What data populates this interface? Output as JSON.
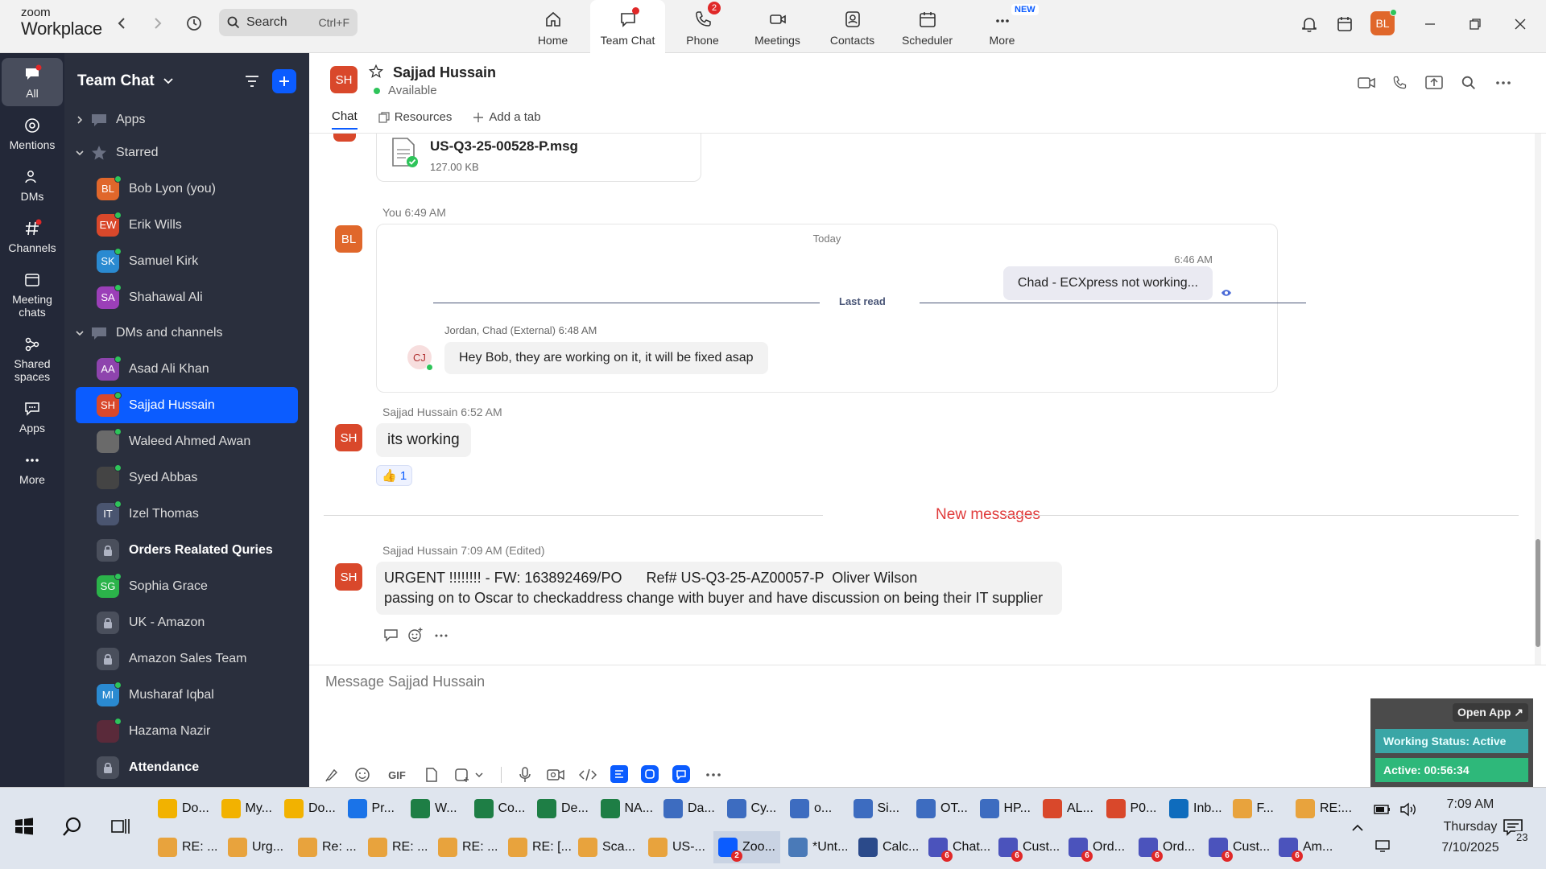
{
  "app": {
    "logo_top": "zoom",
    "logo_bottom": "Workplace",
    "search_placeholder": "Search",
    "search_shortcut": "Ctrl+F",
    "user_initials": "BL"
  },
  "topnav": [
    {
      "label": "Home"
    },
    {
      "label": "Team Chat"
    },
    {
      "label": "Phone",
      "badge": "2"
    },
    {
      "label": "Meetings"
    },
    {
      "label": "Contacts"
    },
    {
      "label": "Scheduler"
    },
    {
      "label": "More",
      "tag": "NEW"
    }
  ],
  "rail": [
    {
      "label": "All"
    },
    {
      "label": "Mentions"
    },
    {
      "label": "DMs"
    },
    {
      "label": "Channels"
    },
    {
      "label": "Meeting chats"
    },
    {
      "label": "Shared spaces"
    },
    {
      "label": "Apps"
    },
    {
      "label": "More"
    }
  ],
  "sidebar": {
    "title": "Team Chat",
    "apps": "Apps",
    "starred": "Starred",
    "dms": "DMs and channels",
    "starred_items": [
      {
        "initials": "BL",
        "name": "Bob Lyon (you)",
        "color": "#e0672b"
      },
      {
        "initials": "EW",
        "name": "Erik Wills",
        "color": "#d9482b"
      },
      {
        "initials": "SK",
        "name": "Samuel Kirk",
        "color": "#2a8ad1"
      },
      {
        "initials": "SA",
        "name": "Shahawal Ali",
        "color": "#9b3fb8"
      }
    ],
    "dm_items": [
      {
        "initials": "AA",
        "name": "Asad Ali Khan",
        "color": "#8e44ad"
      },
      {
        "initials": "SH",
        "name": "Sajjad Hussain",
        "color": "#d9482b"
      },
      {
        "initials": "",
        "name": "Waleed Ahmed Awan",
        "color": "#6a6a6a"
      },
      {
        "initials": "",
        "name": "Syed Abbas",
        "color": "#444"
      },
      {
        "initials": "IT",
        "name": "Izel Thomas",
        "color": "#4a5570"
      },
      {
        "initials": "",
        "name": "Orders Realated Quries",
        "color": "#4a4f5c",
        "lock": true
      },
      {
        "initials": "SG",
        "name": "Sophia Grace",
        "color": "#2bb34a"
      },
      {
        "initials": "",
        "name": "UK - Amazon",
        "color": "#4a4f5c",
        "lock": true
      },
      {
        "initials": "",
        "name": "Amazon Sales Team",
        "color": "#4a4f5c",
        "lock": true
      },
      {
        "initials": "MI",
        "name": "Musharaf Iqbal",
        "color": "#2a8ad1"
      },
      {
        "initials": "",
        "name": "Hazama Nazir",
        "color": "#5a2a3a"
      },
      {
        "initials": "",
        "name": "Attendance",
        "color": "#4a4f5c",
        "lock": true
      }
    ]
  },
  "chat": {
    "initials": "SH",
    "name": "Sajjad Hussain",
    "status": "Available",
    "tabs": [
      "Chat",
      "Resources",
      "Add a tab"
    ],
    "file": {
      "name": "US-Q3-25-00528-P.msg",
      "size": "127.00 KB"
    },
    "msg1": {
      "initials": "BL",
      "meta": "You 6:49 AM",
      "day": "Today",
      "time": "6:46 AM",
      "bubble": "Chad -  ECXpress not working...",
      "last_read": "Last read",
      "reply_meta": "Jordan, Chad (External)  6:48 AM",
      "reply_initials": "CJ",
      "reply_text": "Hey Bob, they are working on it, it will be fixed asap"
    },
    "msg2": {
      "initials": "SH",
      "meta": "Sajjad Hussain 6:52 AM",
      "text": "its working",
      "reaction": "👍 1"
    },
    "new_messages": "New messages",
    "msg3": {
      "initials": "SH",
      "meta": "Sajjad Hussain 7:09 AM (Edited)",
      "line1": "URGENT !!!!!!!! - FW: 163892469/PO      Ref# US-Q3-25-AZ00057-P  Oliver Wilson",
      "line2": "passing on to Oscar to checkaddress change with buyer and have discussion on being their IT supplier"
    },
    "composer_placeholder": "Message Sajjad Hussain",
    "gif": "GIF"
  },
  "widget": {
    "open_app": "Open App ↗",
    "working_status": "Working Status: Active",
    "active": "Active: 00:56:34"
  },
  "taskbar": {
    "row1": [
      {
        "label": "Do...",
        "color": "#f2b200"
      },
      {
        "label": "My...",
        "color": "#f2b200"
      },
      {
        "label": "Do...",
        "color": "#f2b200"
      },
      {
        "label": "Pr...",
        "color": "#1a73e8"
      },
      {
        "label": "W...",
        "color": "#1e7e45"
      },
      {
        "label": "Co...",
        "color": "#1e7e45"
      },
      {
        "label": "De...",
        "color": "#1e7e45"
      },
      {
        "label": "NA...",
        "color": "#1e7e45"
      },
      {
        "label": "Da...",
        "color": "#3d6cc0"
      },
      {
        "label": "Cy...",
        "color": "#3d6cc0"
      },
      {
        "label": "o...",
        "color": "#3d6cc0"
      },
      {
        "label": "Si...",
        "color": "#3d6cc0"
      },
      {
        "label": "OT...",
        "color": "#3d6cc0"
      },
      {
        "label": "HP...",
        "color": "#3d6cc0"
      },
      {
        "label": "AL...",
        "color": "#d9482b"
      },
      {
        "label": "P0...",
        "color": "#d9482b"
      },
      {
        "label": "Inb...",
        "color": "#0f6cbd"
      },
      {
        "label": "F...",
        "color": "#e8a33d"
      },
      {
        "label": "RE:...",
        "color": "#e8a33d"
      }
    ],
    "row2": [
      {
        "label": "RE: ...",
        "color": "#e8a33d"
      },
      {
        "label": "Urg...",
        "color": "#e8a33d"
      },
      {
        "label": "Re: ...",
        "color": "#e8a33d"
      },
      {
        "label": "RE: ...",
        "color": "#e8a33d"
      },
      {
        "label": "RE: ...",
        "color": "#e8a33d"
      },
      {
        "label": "RE: [...",
        "color": "#e8a33d"
      },
      {
        "label": "Sca...",
        "color": "#e8a33d"
      },
      {
        "label": "US-...",
        "color": "#e8a33d"
      },
      {
        "label": "Zoo...",
        "color": "#0b5cff",
        "badge": "2"
      },
      {
        "label": "*Unt...",
        "color": "#4a7ab8"
      },
      {
        "label": "Calc...",
        "color": "#2b4a8a"
      },
      {
        "label": "Chat...",
        "color": "#4b53bc",
        "badge": "6"
      },
      {
        "label": "Cust...",
        "color": "#4b53bc",
        "badge": "6"
      },
      {
        "label": "Ord...",
        "color": "#4b53bc",
        "badge": "6"
      },
      {
        "label": "Ord...",
        "color": "#4b53bc",
        "badge": "6"
      },
      {
        "label": "Cust...",
        "color": "#4b53bc",
        "badge": "6"
      },
      {
        "label": "Am...",
        "color": "#4b53bc",
        "badge": "6"
      }
    ],
    "time": "7:09 AM",
    "day": "Thursday",
    "date": "7/10/2025",
    "notif": "23"
  }
}
